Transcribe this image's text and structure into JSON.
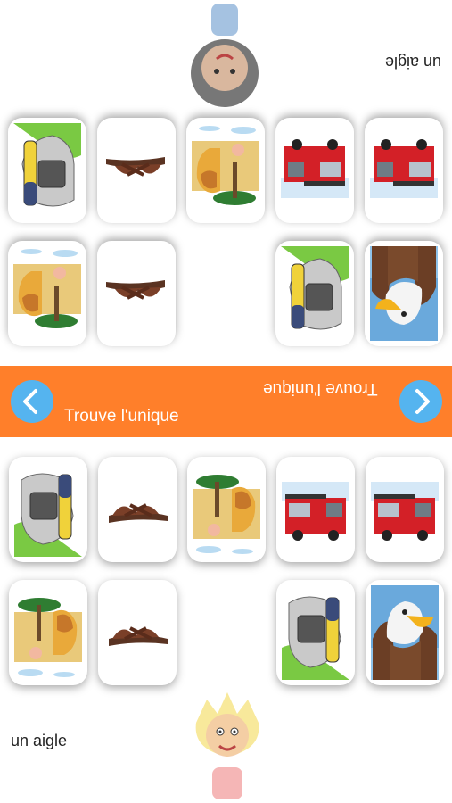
{
  "banner": {
    "title_bottom": "Trouve l'unique",
    "title_top": "Trouve l'unique",
    "left_icon": "chevron-left-icon",
    "right_icon": "chevron-right-icon"
  },
  "player_top": {
    "word": "un aigle",
    "avatar": "boy-avatar"
  },
  "player_bottom": {
    "word": "un aigle",
    "avatar": "blond-boy-avatar"
  },
  "cards": {
    "eagle": "eagle-card",
    "inhaler": "inhaler-card",
    "sandal": "sandal-card",
    "savanna": "savanna-card",
    "firetruck": "fire-truck-card"
  },
  "colors": {
    "banner": "#ff7f2a",
    "button": "#55b4ef"
  }
}
